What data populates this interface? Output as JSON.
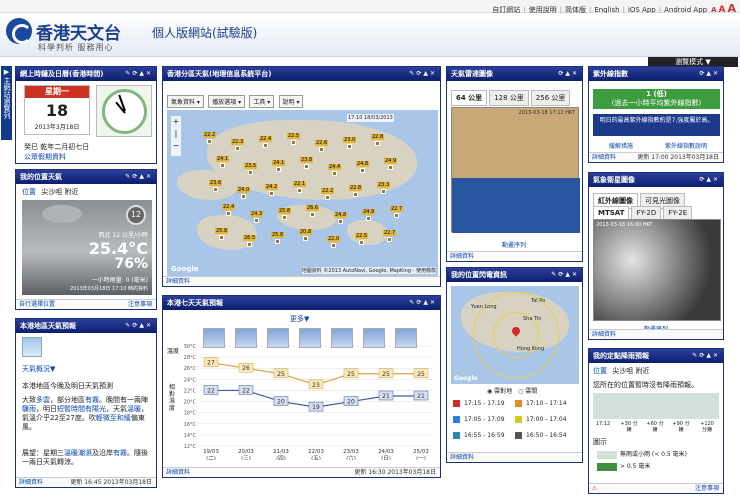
{
  "topbar": {
    "links": [
      "自訂網站",
      "使用說明",
      "简体版",
      "English",
      "iOS App",
      "Android App"
    ],
    "fontsizes": [
      "A",
      "A",
      "A"
    ]
  },
  "header": {
    "title": "香港天文台",
    "subtitle": "個人版網站(試驗版)",
    "slogan": "科學判析 服務用心",
    "mode_button": "瀏覽模式 ▼"
  },
  "sidetab": "主網站瀏覽列",
  "panels": {
    "datetime": {
      "title": "網上時鐘及日曆(香港時間)",
      "weekday": "星期一",
      "day": "18",
      "date": "2013年3月18日",
      "lunar": "癸巳 乾年二月初七日",
      "public_holiday": "公眾假期資料"
    },
    "myweather": {
      "title": "我的位置天氣",
      "loc_label": "位置",
      "loc": "尖沙咀 附近",
      "uv_index": "12",
      "rain_label": "西北 12 公里/小時",
      "temp": "25.4°C",
      "humidity": "76%",
      "rain_amt": "一小時雨量: 0 (毫米)",
      "time": "2013年03月18日 17:10 時的資料",
      "foot_left": "自行選擇位置",
      "foot_right": "注意事項"
    },
    "local": {
      "title": "本港地區天氣預報",
      "link": "天氣概況▼",
      "body": "本港地區今晚及明日天氣預測",
      "p1_parts": [
        "大致",
        "多雲",
        "，部分地區",
        "有霧",
        "。晚間有一兩陣",
        "驟雨",
        "，明日",
        "短暫時間有陽光",
        "，天氣",
        "溫暖",
        "，氣溫介乎22至27度。吹",
        "輕微至和緩",
        "偏東風。"
      ],
      "p2_parts": [
        "展望：星期三",
        "溫暖潮濕",
        "及沿岸",
        "有霧",
        "。隨後一兩日天氣轉涼。"
      ],
      "foot_left": "詳細資料",
      "foot_right": "更新 16:45 2013年03月18日"
    },
    "regional": {
      "title": "香港分區天氣(地理信息系統平台)",
      "btns": [
        "氣象資料",
        "播放選項",
        "工具",
        "說明"
      ],
      "stamp": "17:10 18/03/2013",
      "map_source": "地圖資料 ©2013 AutoNavi, Google, MapKing - 使用條款",
      "foot_left": "詳細資料",
      "temps": [
        "22.2",
        "22.3",
        "22.4",
        "22.5",
        "22.6",
        "23.0",
        "22.8",
        "24.1",
        "23.5",
        "24.1",
        "23.8",
        "24.4",
        "24.8",
        "24.9",
        "23.6",
        "24.0",
        "24.2",
        "22.1",
        "22.2",
        "22.8",
        "23.3",
        "22.4",
        "24.3",
        "25.8",
        "26.6",
        "24.8",
        "24.9",
        "22.7",
        "25.8",
        "26.5",
        "25.8",
        "20.8",
        "22.0",
        "22.5",
        "22.7"
      ],
      "map_label": "Google"
    },
    "radar": {
      "title": "天氣雷達圖像",
      "tabs": [
        "64 公里",
        "128 公里",
        "256 公里"
      ],
      "stamp": "2013-03-18 17:12 HKT",
      "link": "動畫序列",
      "foot_left": "詳細資料"
    },
    "uv": {
      "title": "紫外線指數",
      "value": "1 (低)",
      "value_sub": "(過去一小時平均紫外線指數)",
      "fcst": "明日的最高紫外線指數約是7,強度屬於高。",
      "links": [
        "緩解措施",
        "紫外線指數說明"
      ],
      "foot_left": "詳細資料",
      "foot_right": "更新 17:00 2013年03月18日"
    },
    "sat": {
      "title": "氣象衛星圖像",
      "tabs": [
        "紅外線圖像",
        "可見光圖像"
      ],
      "subtabs": [
        "MTSAT",
        "FY-2D",
        "FY-2E"
      ],
      "stamp": "2013-03-18 16:00 HKT",
      "link": "動畫序列",
      "foot_left": "詳細資料"
    },
    "lightning": {
      "title": "我的位置閃電資訊",
      "radio": [
        "雲對地",
        "雲間"
      ],
      "legend": [
        "17:15 - 17:19",
        "17:10 - 17:14",
        "17:05 - 17:09",
        "17:00 - 17:04",
        "16:55 - 16:59",
        "16:50 - 16:54"
      ],
      "legend_colors": [
        "#d42a2a",
        "#e88a2a",
        "#2a7de0",
        "#d8c820",
        "#2a8ab0",
        "#555555"
      ],
      "foot_left": "詳細資料",
      "map_label": "Google",
      "places": [
        "Yuen Long",
        "Sha Tin",
        "Tai Po",
        "Hong Kong"
      ]
    },
    "rain": {
      "title": "我的定點降雨預報",
      "loc_label": "位置",
      "loc": "尖沙咀 附近",
      "msg": "您所在的位置暫時沒有降雨預報。",
      "times": [
        "17:12",
        "+30 分鐘",
        "+60 分鐘",
        "+90 分鐘",
        "+120 分鐘"
      ],
      "legend_title": "圖示",
      "legend": [
        "無雨或小雨 (< 0.5 毫米)",
        "> 0.5 毫米"
      ],
      "foot_right": "注意事項"
    },
    "nineday": {
      "title": "本港七天天氣預報",
      "more": "更多▼",
      "ylabel_temp": "溫度",
      "ylabel_hum": "相對濕度",
      "foot_left": "詳細資料",
      "foot_right": "更新 16:30 2013年03月18日"
    }
  },
  "chart_data": {
    "type": "line",
    "categories": [
      "19/03 (二)",
      "20/03 (三)",
      "21/03 (四)",
      "22/03 (五)",
      "23/03 (六)",
      "24/03 (日)",
      "25/03 (一)"
    ],
    "series": [
      {
        "name": "max",
        "values": [
          27,
          26,
          25,
          23,
          25,
          25,
          25
        ]
      },
      {
        "name": "min",
        "values": [
          22,
          22,
          20,
          19,
          20,
          21,
          21
        ]
      }
    ],
    "ylabels": [
      "30°C",
      "28°C",
      "26°C",
      "24°C",
      "22°C",
      "20°C",
      "18°C",
      "16°C",
      "14°C",
      "12°C"
    ],
    "ylim": [
      12,
      30
    ],
    "colors": {
      "max": "#d9a441",
      "min": "#3b5ea8"
    }
  }
}
